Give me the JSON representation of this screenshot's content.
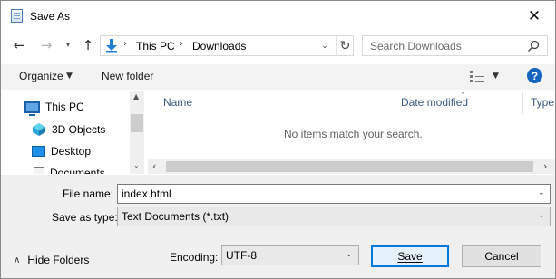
{
  "dialog": {
    "title": "Save As"
  },
  "nav": {
    "breadcrumbs": [
      "This PC",
      "Downloads"
    ],
    "search_placeholder": "Search Downloads"
  },
  "toolbar": {
    "organize": "Organize",
    "new_folder": "New folder"
  },
  "tree": {
    "items": [
      {
        "label": "This PC",
        "icon": "computer-icon"
      },
      {
        "label": "3D Objects",
        "icon": "3d-objects-icon"
      },
      {
        "label": "Desktop",
        "icon": "desktop-icon"
      },
      {
        "label": "Documents",
        "icon": "documents-icon"
      }
    ]
  },
  "filelist": {
    "columns": [
      "Name",
      "Date modified",
      "Type"
    ],
    "empty_message": "No items match your search."
  },
  "fields": {
    "file_name_label": "File name:",
    "file_name_value": "index.html",
    "save_as_type_label": "Save as type:",
    "save_as_type_value": "Text Documents (*.txt)",
    "encoding_label": "Encoding:",
    "encoding_value": "UTF-8"
  },
  "footer": {
    "hide_folders": "Hide Folders",
    "save": "Save",
    "cancel": "Cancel"
  },
  "colors": {
    "accent": "#0078d7",
    "help": "#1565c0",
    "header_text": "#3c5a80"
  }
}
